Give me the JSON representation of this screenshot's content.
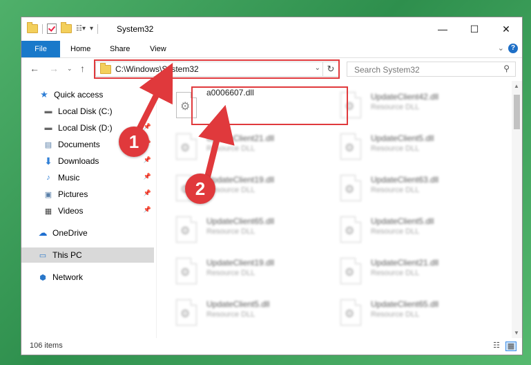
{
  "window": {
    "title": "System32"
  },
  "ribbon": {
    "tabs": [
      "File",
      "Home",
      "Share",
      "View"
    ],
    "help": "?"
  },
  "navbar": {
    "address": "C:\\Windows\\System32",
    "search_placeholder": "Search System32"
  },
  "sidebar": {
    "items": [
      {
        "label": "Quick access",
        "icon": "star-icon",
        "pinned": false
      },
      {
        "label": "Local Disk (C:)",
        "icon": "drive-icon",
        "pinned": false
      },
      {
        "label": "Local Disk (D:)",
        "icon": "drive-icon",
        "pinned": true
      },
      {
        "label": "Documents",
        "icon": "document-icon",
        "pinned": true
      },
      {
        "label": "Downloads",
        "icon": "download-icon",
        "pinned": true
      },
      {
        "label": "Music",
        "icon": "music-icon",
        "pinned": true
      },
      {
        "label": "Pictures",
        "icon": "pictures-icon",
        "pinned": true
      },
      {
        "label": "Videos",
        "icon": "video-icon",
        "pinned": true
      },
      {
        "label": "OneDrive",
        "icon": "cloud-icon",
        "pinned": false
      },
      {
        "label": "This PC",
        "icon": "computer-icon",
        "pinned": false,
        "selected": true
      },
      {
        "label": "Network",
        "icon": "network-icon",
        "pinned": false
      }
    ]
  },
  "files": [
    {
      "name": "a0006607.dll",
      "type": "",
      "highlighted": true,
      "blurred": false
    },
    {
      "name": "UpdateClient42.dll",
      "type": "Resource DLL",
      "blurred": true
    },
    {
      "name": "UpdateClient21.dll",
      "type": "Resource DLL",
      "blurred": true
    },
    {
      "name": "UpdateClient5.dll",
      "type": "Resource DLL",
      "blurred": true
    },
    {
      "name": "UpdateClient19.dll",
      "type": "Resource DLL",
      "blurred": true
    },
    {
      "name": "UpdateClient63.dll",
      "type": "Resource DLL",
      "blurred": true
    },
    {
      "name": "UpdateClient65.dll",
      "type": "Resource DLL",
      "blurred": true
    },
    {
      "name": "UpdateClient5.dll",
      "type": "Resource DLL",
      "blurred": true
    },
    {
      "name": "UpdateClient19.dll",
      "type": "Resource DLL",
      "blurred": true
    },
    {
      "name": "UpdateClient21.dll",
      "type": "Resource DLL",
      "blurred": true
    },
    {
      "name": "UpdateClient5.dll",
      "type": "Resource DLL",
      "blurred": true
    },
    {
      "name": "UpdateClient65.dll",
      "type": "Resource DLL",
      "blurred": true
    }
  ],
  "status": {
    "item_count": "106 items"
  },
  "annotations": {
    "step1": "1",
    "step2": "2",
    "color": "#e0393c"
  }
}
